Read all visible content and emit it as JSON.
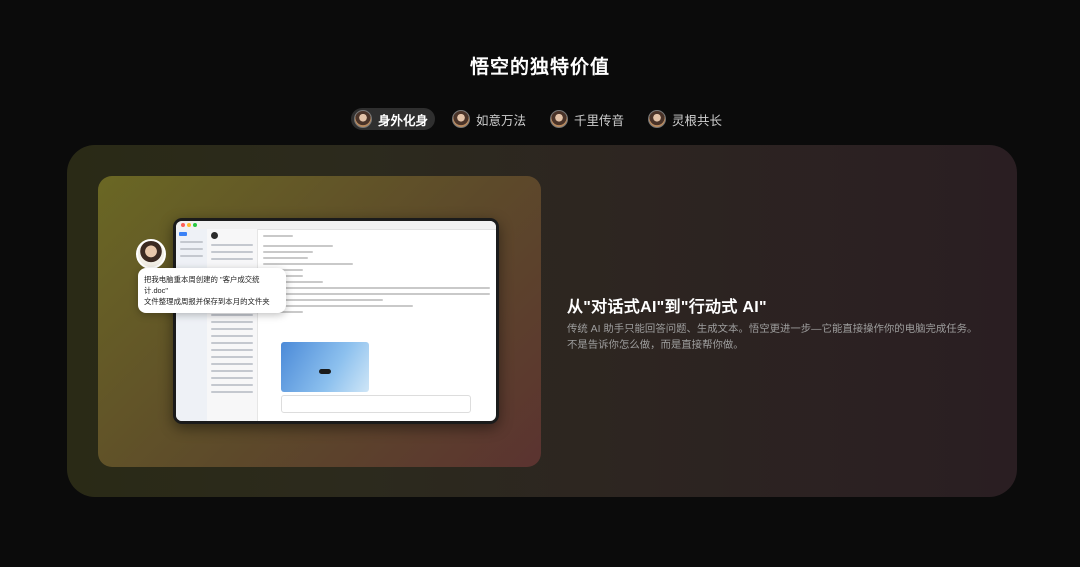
{
  "page": {
    "title": "悟空的独特价值"
  },
  "tabs": [
    {
      "label": "身外化身",
      "active": true
    },
    {
      "label": "如意万法",
      "active": false
    },
    {
      "label": "千里传音",
      "active": false
    },
    {
      "label": "灵根共长",
      "active": false
    }
  ],
  "feature": {
    "heading": "从\"对话式AI\"到\"行动式 AI\"",
    "description": "传统 AI 助手只能回答问题、生成文本。悟空更进一步—它能直接操作你的电脑完成任务。不是告诉你怎么做，而是直接帮你做。"
  },
  "chat_bubble": {
    "line1": "把我电脑重本周创建的 \"客户成交统计.doc\"",
    "line2": "文件整理成周报并保存到本月的文件夹"
  },
  "colors": {
    "background": "#0b0b0b",
    "tab_active_bg": "#2f2f2f",
    "description": "#9e9e9e"
  }
}
